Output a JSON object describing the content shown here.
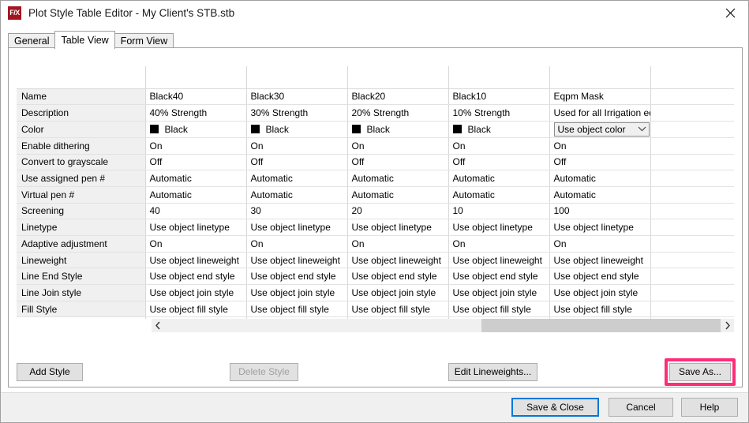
{
  "window": {
    "title": "Plot Style Table Editor - My Client's STB.stb",
    "app_icon": "fx-logo-icon",
    "close_icon": "close-icon",
    "brand_color": "#a31621"
  },
  "tabs": [
    {
      "label": "General",
      "active": false
    },
    {
      "label": "Table View",
      "active": true
    },
    {
      "label": "Form View",
      "active": false
    }
  ],
  "table": {
    "row_labels": [
      "Name",
      "Description",
      "Color",
      "Enable dithering",
      "Convert to grayscale",
      "Use assigned pen #",
      "Virtual pen #",
      "Screening",
      "Linetype",
      "Adaptive adjustment",
      "Lineweight",
      "Line End Style",
      "Line Join style",
      "Fill Style"
    ],
    "columns": [
      {
        "name": "Black40",
        "description": "40% Strength",
        "color": "Black",
        "color_swatch": "#000000",
        "enable_dithering": "On",
        "convert_to_grayscale": "Off",
        "use_assigned_pen": "Automatic",
        "virtual_pen": "Automatic",
        "screening": "40",
        "linetype": "Use object linetype",
        "adaptive_adjustment": "On",
        "lineweight": "Use object lineweight",
        "line_end_style": "Use object end style",
        "line_join_style": "Use object join style",
        "fill_style": "Use object fill style",
        "color_is_combo": false
      },
      {
        "name": "Black30",
        "description": "30% Strength",
        "color": "Black",
        "color_swatch": "#000000",
        "enable_dithering": "On",
        "convert_to_grayscale": "Off",
        "use_assigned_pen": "Automatic",
        "virtual_pen": "Automatic",
        "screening": "30",
        "linetype": "Use object linetype",
        "adaptive_adjustment": "On",
        "lineweight": "Use object lineweight",
        "line_end_style": "Use object end style",
        "line_join_style": "Use object join style",
        "fill_style": "Use object fill style",
        "color_is_combo": false
      },
      {
        "name": "Black20",
        "description": "20% Strength",
        "color": "Black",
        "color_swatch": "#000000",
        "enable_dithering": "On",
        "convert_to_grayscale": "Off",
        "use_assigned_pen": "Automatic",
        "virtual_pen": "Automatic",
        "screening": "20",
        "linetype": "Use object linetype",
        "adaptive_adjustment": "On",
        "lineweight": "Use object lineweight",
        "line_end_style": "Use object end style",
        "line_join_style": "Use object join style",
        "fill_style": "Use object fill style",
        "color_is_combo": false
      },
      {
        "name": "Black10",
        "description": "10% Strength",
        "color": "Black",
        "color_swatch": "#000000",
        "enable_dithering": "On",
        "convert_to_grayscale": "Off",
        "use_assigned_pen": "Automatic",
        "virtual_pen": "Automatic",
        "screening": "10",
        "linetype": "Use object linetype",
        "adaptive_adjustment": "On",
        "lineweight": "Use object lineweight",
        "line_end_style": "Use object end style",
        "line_join_style": "Use object join style",
        "fill_style": "Use object fill style",
        "color_is_combo": false
      },
      {
        "name": "Eqpm Mask",
        "description": "Used for all Irrigation eqpm",
        "color": "Use object color",
        "color_swatch": null,
        "enable_dithering": "On",
        "convert_to_grayscale": "Off",
        "use_assigned_pen": "Automatic",
        "virtual_pen": "Automatic",
        "screening": "100",
        "linetype": "Use object linetype",
        "adaptive_adjustment": "On",
        "lineweight": "Use object lineweight",
        "line_end_style": "Use object end style",
        "line_join_style": "Use object join style",
        "fill_style": "Use object fill style",
        "color_is_combo": true
      }
    ]
  },
  "scrollbar": {
    "left_icon": "chevron-left-icon",
    "right_icon": "chevron-right-icon"
  },
  "panel_buttons": {
    "add_style": "Add Style",
    "delete_style": "Delete Style",
    "edit_lineweights": "Edit Lineweights...",
    "save_as": "Save As..."
  },
  "bottom_buttons": {
    "save_close": "Save & Close",
    "cancel": "Cancel",
    "help": "Help"
  },
  "annotation": {
    "highlight_target": "save-as-button",
    "highlight_color": "#ff2d78"
  },
  "focus": {
    "default_button": "save-close-button",
    "focus_color": "#0078d7"
  }
}
